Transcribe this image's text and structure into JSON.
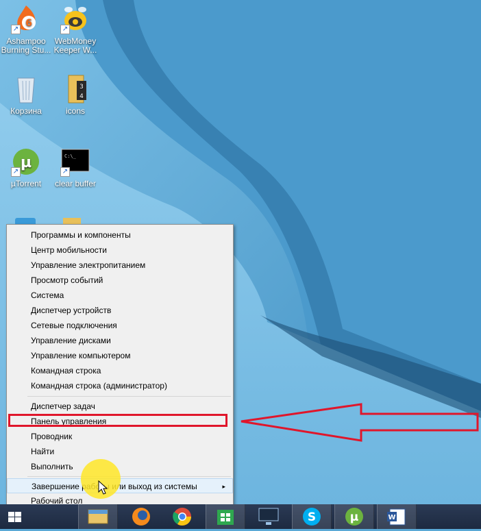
{
  "desktop_icons": [
    {
      "name": "ashampoo",
      "label": "Ashampoo Burning Stu...",
      "icon": "flame-6-icon"
    },
    {
      "name": "webmoney",
      "label": "WebMoney Keeper W...",
      "icon": "bee-icon"
    },
    {
      "name": "korzina",
      "label": "Корзина",
      "icon": "recycle-bin-icon"
    },
    {
      "name": "icons",
      "label": "icons",
      "icon": "folder-icon"
    },
    {
      "name": "utorrent",
      "label": "µTorrent",
      "icon": "utorrent-icon"
    },
    {
      "name": "clear-buffer",
      "label": "clear buffer",
      "icon": "cmd-icon"
    }
  ],
  "menu": {
    "items": [
      "Программы и компоненты",
      "Центр мобильности",
      "Управление электропитанием",
      "Просмотр событий",
      "Система",
      "Диспетчер устройств",
      "Сетевые подключения",
      "Управление дисками",
      "Управление компьютером",
      "Командная строка",
      "Командная строка (администратор)",
      "Диспетчер задач",
      "Панель управления",
      "Проводник",
      "Найти",
      "Выполнить",
      "Завершение работы или выход из системы",
      "Рабочий стол"
    ],
    "submenu_arrow": "▸"
  },
  "taskbar": {
    "icons": [
      "windows-start-icon",
      "explorer-icon",
      "firefox-icon",
      "chrome-icon",
      "store-icon",
      "monitor-icon",
      "skype-icon",
      "utorrent-icon",
      "word-icon"
    ]
  },
  "colors": {
    "highlight": "#e0162b",
    "cursor_spot": "#ffe628"
  }
}
